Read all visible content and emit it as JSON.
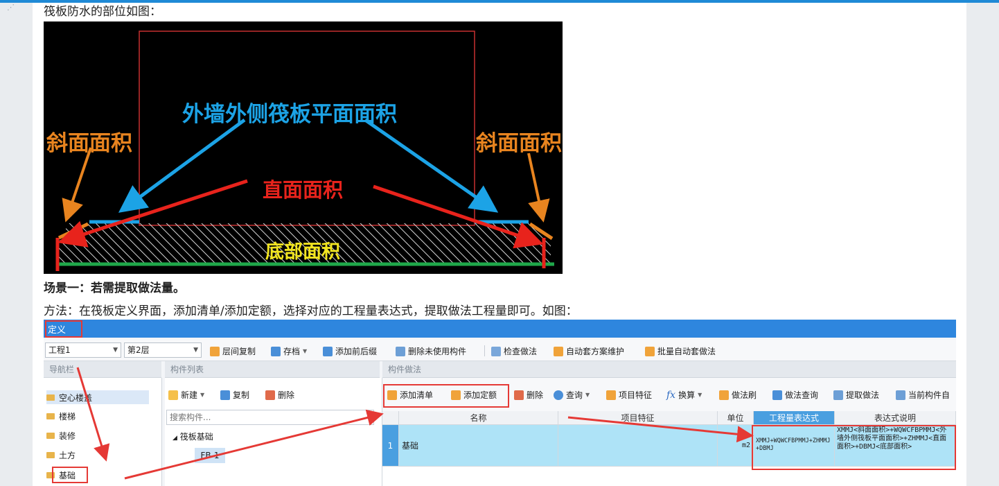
{
  "article": {
    "intro": "筏板防水的部位如图：",
    "scenario_title": "场景一：若需提取做法量。",
    "method_text": "方法：在筏板定义界面，添加清单/添加定额，选择对应的工程量表达式，提取做法工程量即可。如图："
  },
  "figure": {
    "label_top": "外墙外侧筏板平面面积",
    "label_left": "斜面面积",
    "label_right": "斜面面积",
    "label_mid": "直面面积",
    "label_bottom": "底部面积",
    "colors": {
      "blue": "#1ca3e6",
      "orange": "#e8841f",
      "red": "#e8231c",
      "yellow": "#f2e51f",
      "green": "#1fa84a",
      "outline": "#c83030"
    }
  },
  "app": {
    "title": "定义",
    "toolbar": {
      "project": "工程1",
      "floor": "第2层",
      "buttons": [
        "层间复制",
        "存档",
        "添加前后缀",
        "删除未使用构件",
        "检查做法",
        "自动套方案维护",
        "批量自动套做法"
      ]
    },
    "nav": {
      "header": "导航栏",
      "items": [
        "空心楼盖",
        "楼梯",
        "装修",
        "土方",
        "基础"
      ]
    },
    "components": {
      "header": "构件列表",
      "buttons": [
        "新建",
        "复制",
        "删除"
      ],
      "search_placeholder": "搜索构件...",
      "tree_parent": "筏板基础",
      "tree_child": "FB-1"
    },
    "methods": {
      "header": "构件做法",
      "buttons": [
        "添加清单",
        "添加定额",
        "删除",
        "查询",
        "项目特征",
        "换算",
        "做法刷",
        "做法查询",
        "提取做法",
        "当前构件自"
      ],
      "columns": [
        "名称",
        "项目特征",
        "单位",
        "工程量表达式",
        "表达式说明"
      ],
      "row": {
        "index": "1",
        "name": "基础",
        "feature": "",
        "unit": "m2",
        "expression": "XMMJ+WQWCFBPMMJ+ZHMMJ+DBMJ",
        "explanation": "XMMJ<斜面面积>+WQWCFBPMMJ<外墙外侧筏板平面面积>+ZHMMJ<直面面积>+DBMJ<底部面积>"
      }
    }
  }
}
